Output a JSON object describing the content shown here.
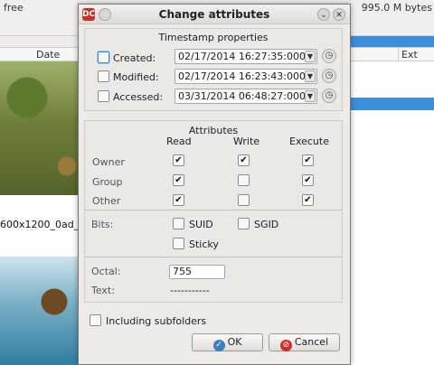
{
  "background": {
    "free_label": "free",
    "size_label": "995.0 M bytes",
    "date_column": "Date",
    "ext_column": "Ext",
    "thumb_label": "600x1200_0ad_"
  },
  "dialog": {
    "title": "Change attributes",
    "app_icon_glyph": "DC",
    "timestamps": {
      "title": "Timestamp properties",
      "rows": [
        {
          "label": "Created:",
          "checked": false,
          "value": "02/17/2014    16:27:35:000"
        },
        {
          "label": "Modified:",
          "checked": false,
          "value": "02/17/2014    16:23:43:000"
        },
        {
          "label": "Accessed:",
          "checked": false,
          "value": "03/31/2014    06:48:27:000"
        }
      ]
    },
    "attributes": {
      "title": "Attributes",
      "columns": [
        "Read",
        "Write",
        "Execute"
      ],
      "rows": [
        {
          "label": "Owner",
          "read": true,
          "write": true,
          "execute": true
        },
        {
          "label": "Group",
          "read": true,
          "write": false,
          "execute": true
        },
        {
          "label": "Other",
          "read": true,
          "write": false,
          "execute": true
        }
      ]
    },
    "bits": {
      "label": "Bits:",
      "suid": {
        "label": "SUID",
        "checked": false
      },
      "sgid": {
        "label": "SGID",
        "checked": false
      },
      "sticky": {
        "label": "Sticky",
        "checked": false
      }
    },
    "octal": {
      "label": "Octal:",
      "value": "755"
    },
    "text": {
      "label": "Text:",
      "value": "-----------"
    },
    "subfolders": {
      "label": "Including subfolders",
      "checked": false
    },
    "ok_label": "OK",
    "cancel_label": "Cancel",
    "check_glyph": "✔"
  },
  "colors": {
    "selection_blue": "#3d8fd8",
    "dialog_bg": "#edebe7",
    "cancel_red": "#c9302c",
    "ok_blue": "#3f7fc0"
  }
}
